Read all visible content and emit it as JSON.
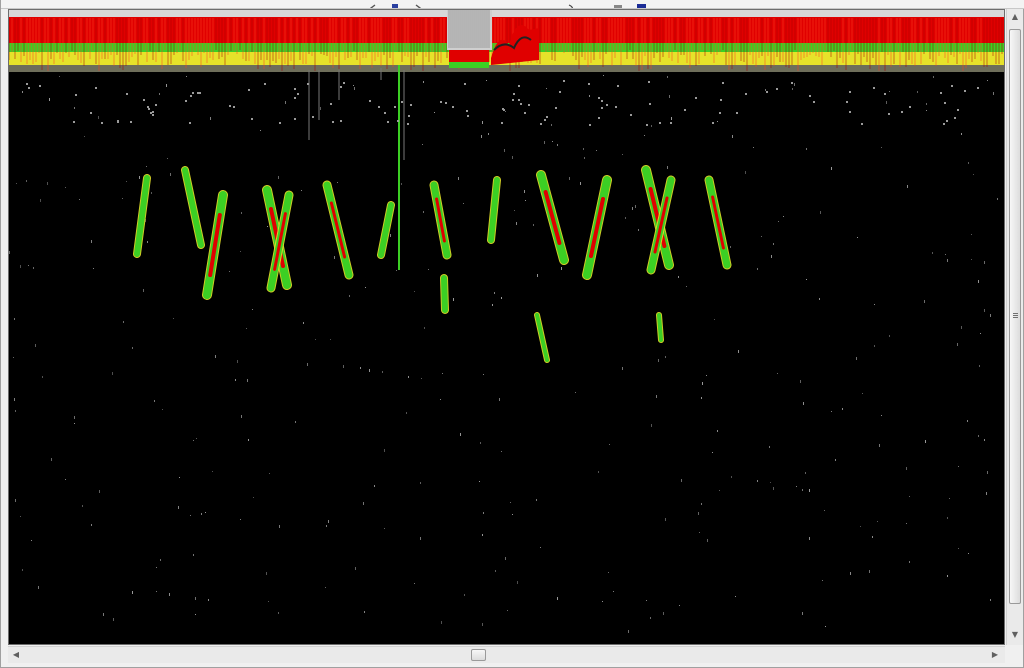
{
  "window": {
    "toolbar_icons": [
      "nav-back-icon",
      "save-icon",
      "nav-forward-icon",
      "tool-icon",
      "print-icon",
      "color-swatch-icon"
    ]
  },
  "echogram": {
    "colors": {
      "background": "#000000",
      "strong": "#e00000",
      "medium": "#3ccf24",
      "weak": "#e6e22a",
      "faint": "#9a9a9a"
    }
  },
  "scrollbars": {
    "vertical": {
      "up_arrow": "▲",
      "down_arrow": "▼",
      "position": 0.03
    },
    "horizontal": {
      "left_arrow": "◀",
      "right_arrow": "▶",
      "position": 0.47
    }
  }
}
